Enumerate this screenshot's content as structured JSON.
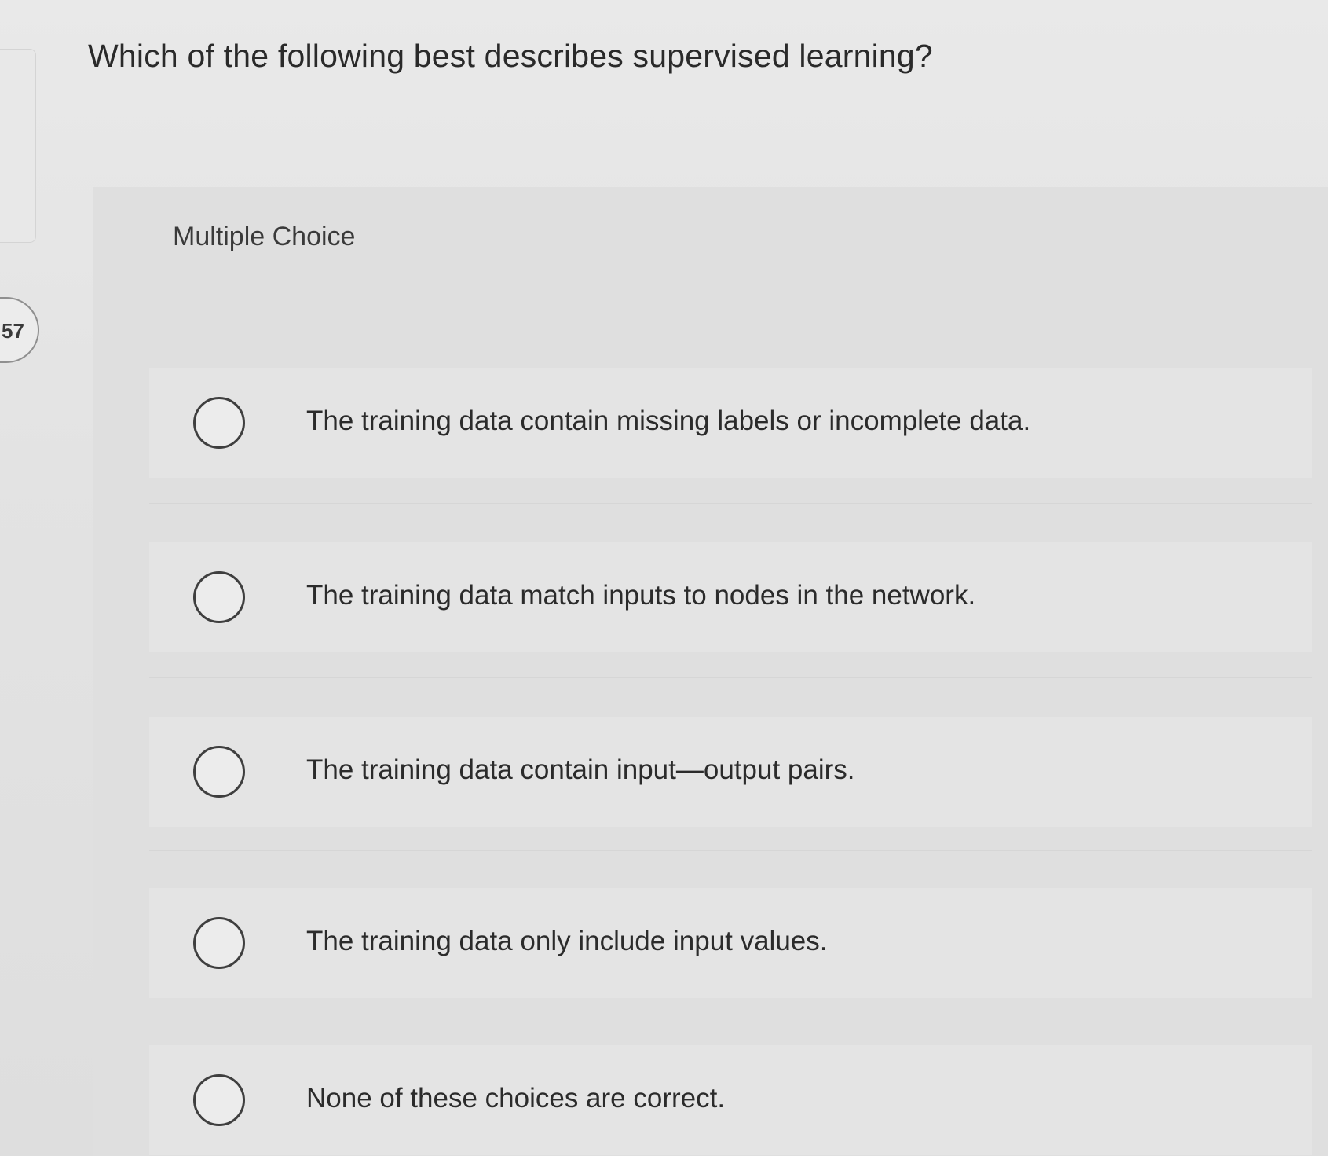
{
  "question": {
    "number": "57",
    "text": "Which of the following best describes supervised learning?",
    "type": "Multiple Choice"
  },
  "options": [
    {
      "label": "The training data contain missing labels or incomplete data.",
      "selected": false
    },
    {
      "label": "The training data match inputs to nodes in the network.",
      "selected": false
    },
    {
      "label": "The training data contain input—output pairs.",
      "selected": false
    },
    {
      "label": "The training data only include input values.",
      "selected": false
    },
    {
      "label": "None of these choices are correct.",
      "selected": false
    }
  ]
}
